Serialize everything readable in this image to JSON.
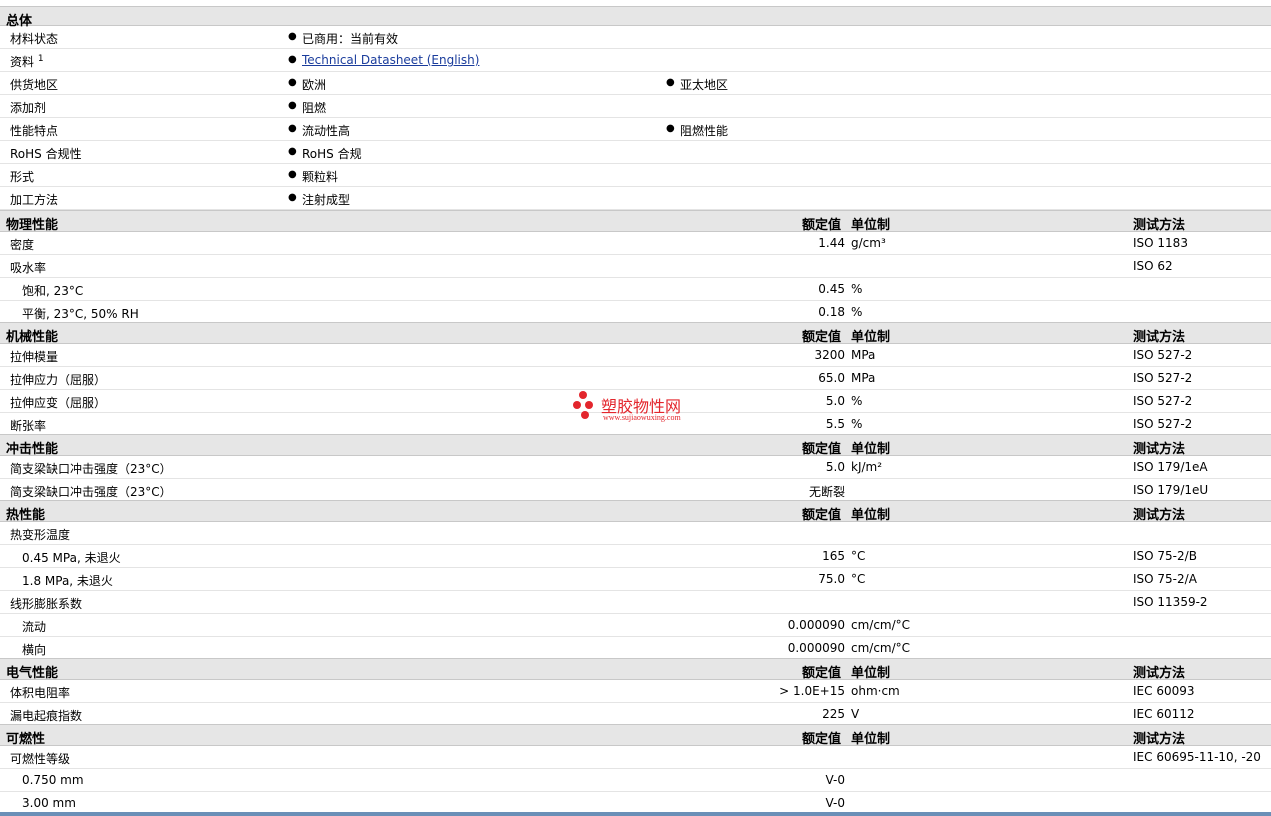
{
  "sections": {
    "general": "总体",
    "physical": "物理性能",
    "mechanical": "机械性能",
    "impact": "冲击性能",
    "thermal": "热性能",
    "electrical": "电气性能",
    "flammability": "可燃性"
  },
  "headers": {
    "value": "额定值",
    "unit": "单位制",
    "method": "测试方法"
  },
  "bullet": "●",
  "general": {
    "status_label": "材料状态",
    "status_value": "已商用：当前有效",
    "doc_label": "资料",
    "doc_sup": "1",
    "doc_link": "Technical Datasheet (English)",
    "region_label": "供货地区",
    "region_1": "欧洲",
    "region_2": "亚太地区",
    "additive_label": "添加剂",
    "additive_value": "阻燃",
    "feature_label": "性能特点",
    "feature_1": "流动性高",
    "feature_2": "阻燃性能",
    "rohs_label": "RoHS 合规性",
    "rohs_value": "RoHS 合规",
    "form_label": "形式",
    "form_value": "颗粒料",
    "process_label": "加工方法",
    "process_value": "注射成型"
  },
  "physical": [
    {
      "label": "密度",
      "value": "1.44",
      "unit": "g/cm³",
      "method": "ISO 1183"
    },
    {
      "label": "吸水率",
      "value": "",
      "unit": "",
      "method": "ISO 62"
    },
    {
      "label": "饱和, 23°C",
      "value": "0.45",
      "unit": "%",
      "method": ""
    },
    {
      "label": "平衡, 23°C, 50% RH",
      "value": "0.18",
      "unit": "%",
      "method": ""
    }
  ],
  "mechanical": [
    {
      "label": "拉伸模量",
      "value": "3200",
      "unit": "MPa",
      "method": "ISO 527-2"
    },
    {
      "label": "拉伸应力（屈服）",
      "value": "65.0",
      "unit": "MPa",
      "method": "ISO 527-2"
    },
    {
      "label": "拉伸应变（屈服）",
      "value": "5.0",
      "unit": "%",
      "method": "ISO 527-2"
    },
    {
      "label": "断张率",
      "value": "5.5",
      "unit": "%",
      "method": "ISO 527-2"
    }
  ],
  "impact": [
    {
      "label": "简支梁缺口冲击强度（23°C）",
      "value": "5.0",
      "unit": "kJ/m²",
      "method": "ISO 179/1eA"
    },
    {
      "label": "简支梁缺口冲击强度（23°C）",
      "value": "无断裂",
      "unit": "",
      "method": "ISO 179/1eU"
    }
  ],
  "thermal": [
    {
      "label": "热变形温度",
      "value": "",
      "unit": "",
      "method": ""
    },
    {
      "label": "0.45 MPa, 未退火",
      "value": "165",
      "unit": "°C",
      "method": "ISO 75-2/B"
    },
    {
      "label": "1.8 MPa, 未退火",
      "value": "75.0",
      "unit": "°C",
      "method": "ISO 75-2/A"
    },
    {
      "label": "线形膨胀系数",
      "value": "",
      "unit": "",
      "method": "ISO 11359-2"
    },
    {
      "label": "流动",
      "value": "0.000090",
      "unit": "cm/cm/°C",
      "method": ""
    },
    {
      "label": "横向",
      "value": "0.000090",
      "unit": "cm/cm/°C",
      "method": ""
    }
  ],
  "electrical": [
    {
      "label": "体积电阻率",
      "value": "> 1.0E+15",
      "unit": "ohm·cm",
      "method": "IEC 60093"
    },
    {
      "label": "漏电起痕指数",
      "value": "225",
      "unit": "V",
      "method": "IEC 60112"
    }
  ],
  "flammability": [
    {
      "label": "可燃性等级",
      "value": "",
      "unit": "",
      "method": "IEC 60695-11-10, -20"
    },
    {
      "label": "0.750 mm",
      "value": "V-0",
      "unit": "",
      "method": ""
    },
    {
      "label": "3.00 mm",
      "value": "V-0",
      "unit": "",
      "method": ""
    }
  ],
  "watermark": {
    "cn": "塑胶物性网",
    "en": "www.sujiaowuxing.com",
    "color": "#e3262d"
  },
  "colors": {
    "section_bg": "#e6e6e6",
    "link": "#1a3c9c",
    "bottom_bar": "#6b8fb7"
  }
}
